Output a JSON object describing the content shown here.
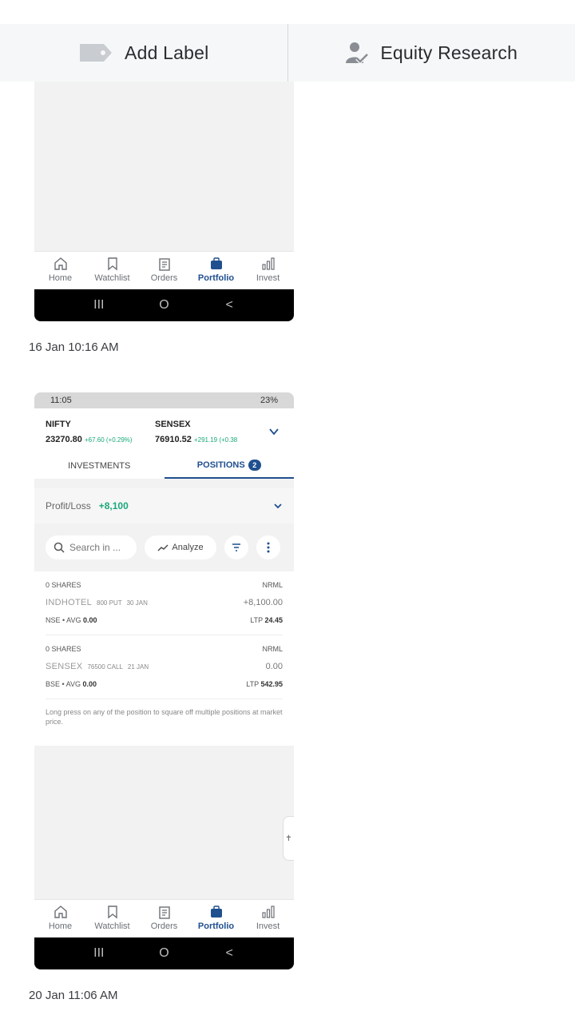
{
  "toolbar": {
    "add_label": "Add Label",
    "equity_research": "Equity Research"
  },
  "nav_items": [
    "Home",
    "Watchlist",
    "Orders",
    "Portfolio",
    "Invest"
  ],
  "nav_active": "Portfolio",
  "sysbar": {
    "recents": "III",
    "home": "O",
    "back": "<"
  },
  "shot1": {
    "timestamp": "16 Jan 10:16 AM"
  },
  "shot2": {
    "timestamp": "20 Jan 11:06 AM",
    "statusbar": {
      "time": "11:05",
      "battery": "23%"
    },
    "nifty": {
      "name": "NIFTY",
      "value": "23270.80",
      "change": "+67.60 (+0.29%)"
    },
    "sensex": {
      "name": "SENSEX",
      "value": "76910.52",
      "change": "+291.19 (+0.38"
    },
    "tabs": {
      "investments": "INVESTMENTS",
      "positions": "POSITIONS",
      "positions_count": "2"
    },
    "pl": {
      "label": "Profit/Loss",
      "value": "+8,100"
    },
    "search_placeholder": "Search in ...",
    "analyze": "Analyze",
    "positions": [
      {
        "shares": "0 SHARES",
        "product": "NRML",
        "symbol": "INDHOTEL",
        "strike": "800 PUT",
        "expiry": "30 JAN",
        "pnl": "+8,100.00",
        "exchange": "NSE • AVG",
        "avg": "0.00",
        "ltp_label": "LTP",
        "ltp": "24.45"
      },
      {
        "shares": "0 SHARES",
        "product": "NRML",
        "symbol": "SENSEX",
        "strike": "76500 CALL",
        "expiry": "21 JAN",
        "pnl": "0.00",
        "exchange": "BSE • AVG",
        "avg": "0.00",
        "ltp_label": "LTP",
        "ltp": "542.95"
      }
    ],
    "hint": "Long press on any of the position to square off multiple positions at market price."
  },
  "colors": {
    "accent": "#1f4f8f",
    "positive": "#1aa87a"
  }
}
